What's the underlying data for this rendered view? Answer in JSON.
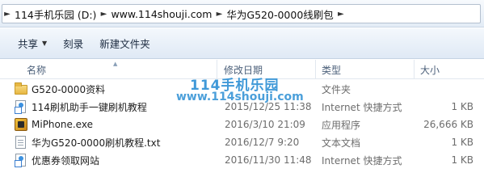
{
  "address": {
    "crumbs": [
      "114手机乐园 (D:)",
      "www.114shouji.com",
      "华为G520-0000线刷包"
    ]
  },
  "toolbar": {
    "share_label": "共享",
    "burn_label": "刻录",
    "new_folder_label": "新建文件夹"
  },
  "columns": {
    "name": "名称",
    "modified": "修改日期",
    "type": "类型",
    "size": "大小"
  },
  "files": [
    {
      "name": "G520-0000资料",
      "modified": "",
      "type": "文件夹",
      "size": "",
      "icon": "folder-icon"
    },
    {
      "name": "114刷机助手一键刷机教程",
      "modified": "2015/12/25 11:38",
      "type": "Internet 快捷方式",
      "size": "1 KB",
      "icon": "shortcut-icon"
    },
    {
      "name": "MiPhone.exe",
      "modified": "2016/3/10 21:09",
      "type": "应用程序",
      "size": "26,666 KB",
      "icon": "exe-icon"
    },
    {
      "name": "华为G520-0000刷机教程.txt",
      "modified": "2016/12/7 9:20",
      "type": "文本文档",
      "size": "1 KB",
      "icon": "text-file-icon"
    },
    {
      "name": "优惠券领取网站",
      "modified": "2016/11/30 11:48",
      "type": "Internet 快捷方式",
      "size": "1 KB",
      "icon": "shortcut-icon"
    }
  ],
  "watermark": {
    "line1": "114手机乐园",
    "line2": "www.114shouji.com"
  }
}
